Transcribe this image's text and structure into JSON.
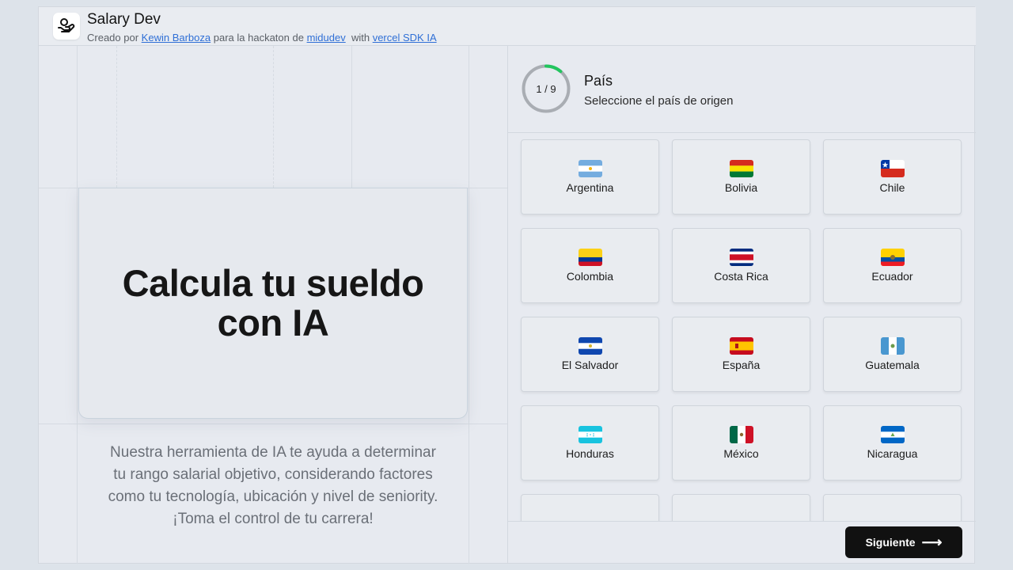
{
  "header": {
    "title": "Salary Dev",
    "credit_prefix": "Creado por",
    "author": "Kewin Barboza",
    "middle": "para la hackaton de",
    "event": "midudev",
    "with_text": "with",
    "sdk": "vercel SDK IA"
  },
  "hero": {
    "title_line1": "Calcula tu sueldo",
    "title_line2": "con IA",
    "description": "Nuestra herramienta de IA te ayuda a determinar tu rango salarial objetivo, considerando factores como tu tecnología, ubicación y nivel de seniority. ¡Toma el control de tu carrera!"
  },
  "step": {
    "progress_label": "1 / 9",
    "current": 1,
    "total": 9,
    "title": "País",
    "subtitle": "Seleccione el país de origen"
  },
  "countries": [
    {
      "name": "Argentina",
      "flag": "argentina-flag"
    },
    {
      "name": "Bolivia",
      "flag": "bolivia-flag"
    },
    {
      "name": "Chile",
      "flag": "chile-flag"
    },
    {
      "name": "Colombia",
      "flag": "colombia-flag"
    },
    {
      "name": "Costa Rica",
      "flag": "costa-rica-flag"
    },
    {
      "name": "Ecuador",
      "flag": "ecuador-flag"
    },
    {
      "name": "El Salvador",
      "flag": "el-salvador-flag"
    },
    {
      "name": "España",
      "flag": "spain-flag"
    },
    {
      "name": "Guatemala",
      "flag": "guatemala-flag"
    },
    {
      "name": "Honduras",
      "flag": "honduras-flag"
    },
    {
      "name": "México",
      "flag": "mexico-flag"
    },
    {
      "name": "Nicaragua",
      "flag": "nicaragua-flag"
    }
  ],
  "footer": {
    "next_label": "Siguiente",
    "next_icon": "arrow-right-icon"
  },
  "colors": {
    "accent_progress": "#22c55e",
    "button_bg": "#111111",
    "link": "#2f6fd6"
  }
}
